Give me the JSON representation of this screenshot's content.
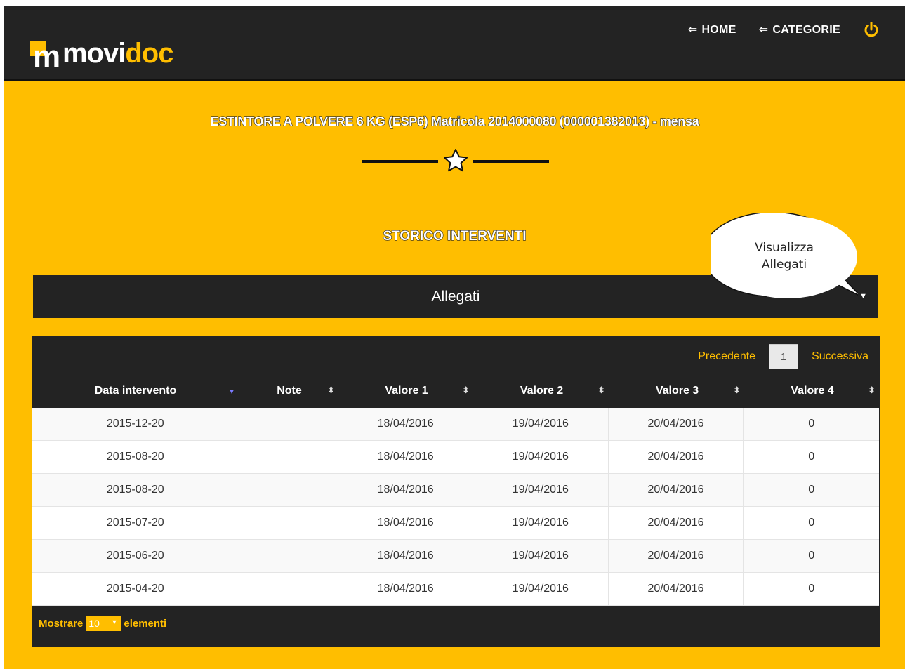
{
  "header": {
    "logo_part1": "movi",
    "logo_part2": "doc",
    "logo_mark": "m",
    "nav": [
      {
        "arrow": "⇐",
        "label": "HOME"
      },
      {
        "arrow": "⇐",
        "label": "CATEGORIE"
      }
    ],
    "power_icon": "power-icon",
    "colors": {
      "accent": "#FFBE00",
      "dark": "#232323"
    }
  },
  "page": {
    "title": "ESTINTORE A POLVERE 6 KG (ESP6) Matricola 2014000080 (000001382013) - mensa",
    "section_title": "STORICO INTERVENTI"
  },
  "allegati": {
    "label": "Allegati",
    "caret": "▼"
  },
  "callout": {
    "line1": "Visualizza",
    "line2": "Allegati"
  },
  "table": {
    "pager": {
      "prev": "Precedente",
      "page": "1",
      "next": "Successiva"
    },
    "columns": [
      "Data intervento",
      "Note",
      "Valore 1",
      "Valore 2",
      "Valore 3",
      "Valore 4"
    ],
    "rows": [
      [
        "2015-12-20",
        "",
        "18/04/2016",
        "19/04/2016",
        "20/04/2016",
        "0"
      ],
      [
        "2015-08-20",
        "",
        "18/04/2016",
        "19/04/2016",
        "20/04/2016",
        "0"
      ],
      [
        "2015-08-20",
        "",
        "18/04/2016",
        "19/04/2016",
        "20/04/2016",
        "0"
      ],
      [
        "2015-07-20",
        "",
        "18/04/2016",
        "19/04/2016",
        "20/04/2016",
        "0"
      ],
      [
        "2015-06-20",
        "",
        "18/04/2016",
        "19/04/2016",
        "20/04/2016",
        "0"
      ],
      [
        "2015-04-20",
        "",
        "18/04/2016",
        "19/04/2016",
        "20/04/2016",
        "0"
      ]
    ],
    "footer": {
      "before": "Mostrare",
      "page_length": "10",
      "after": "elementi"
    }
  }
}
